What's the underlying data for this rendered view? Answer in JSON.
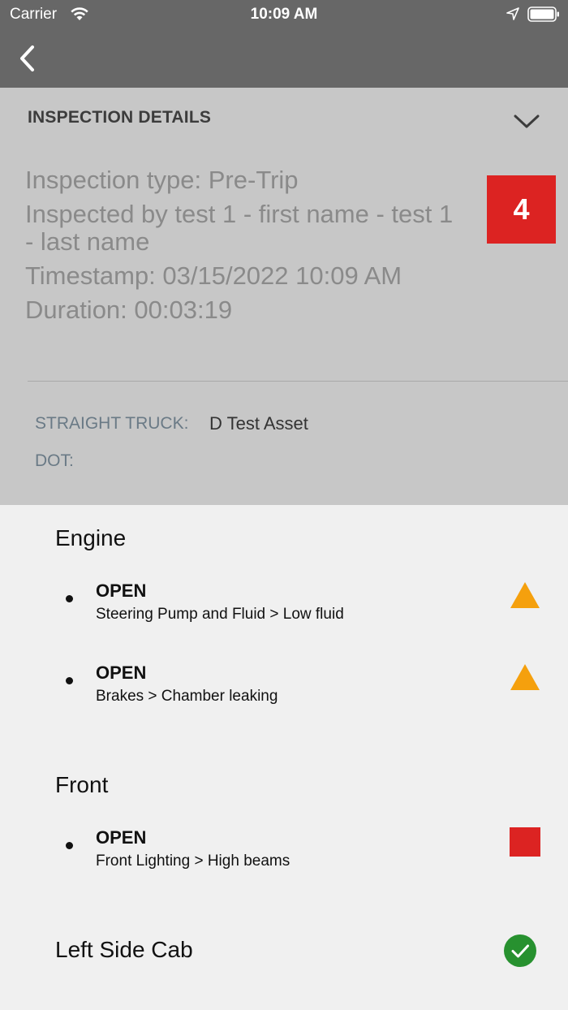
{
  "status_bar": {
    "carrier": "Carrier",
    "time": "10:09 AM"
  },
  "details": {
    "section_title": "INSPECTION DETAILS",
    "inspection_type": "Inspection type: Pre-Trip",
    "inspected_by": "Inspected by test 1 - first name - test 1 - last name",
    "timestamp": "Timestamp: 03/15/2022 10:09 AM",
    "duration": "Duration: 00:03:19",
    "defect_count": "4",
    "asset_label": "STRAIGHT TRUCK:",
    "asset_value": "D Test Asset",
    "dot_label": "DOT:"
  },
  "groups": {
    "engine": {
      "title": "Engine",
      "items": [
        {
          "status": "OPEN",
          "description": "Steering Pump and Fluid > Low fluid",
          "severity": "warning-triangle-icon"
        },
        {
          "status": "OPEN",
          "description": "Brakes > Chamber leaking",
          "severity": "warning-triangle-icon"
        }
      ]
    },
    "front": {
      "title": "Front",
      "items": [
        {
          "status": "OPEN",
          "description": "Front Lighting > High beams",
          "severity": "critical-square-icon"
        }
      ]
    },
    "left_side_cab": {
      "title": "Left Side Cab",
      "state": "check-circle-icon"
    }
  },
  "colors": {
    "header": "#676767",
    "details_bg": "#c7c7c7",
    "badge": "#dc2322",
    "warning": "#f5a00d",
    "critical": "#dc2322",
    "ok": "#27912f"
  }
}
